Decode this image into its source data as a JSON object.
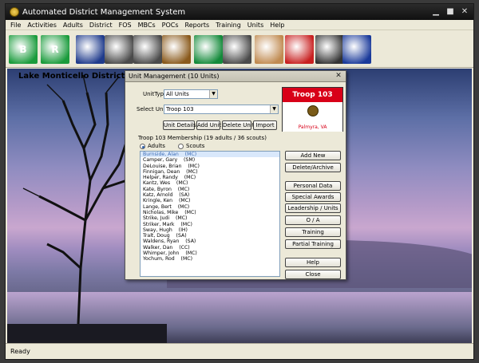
{
  "window": {
    "title": "Automated District Management System"
  },
  "menu": [
    "File",
    "Activities",
    "Adults",
    "District",
    "FOS",
    "MBCs",
    "POCs",
    "Reports",
    "Training",
    "Units",
    "Help"
  ],
  "toolbar": [
    {
      "name": "boys-to-men-icon",
      "label": "B",
      "color": "#1a9b3c"
    },
    {
      "name": "experience-icon",
      "label": "R",
      "color": "#1a9b3c"
    },
    {
      "name": "book-icon",
      "label": "",
      "color": "#1f3b8c"
    },
    {
      "name": "magnifier-icon",
      "label": "",
      "color": "#4a4a4a"
    },
    {
      "name": "register-icon",
      "label": "",
      "color": "#4a4a4a"
    },
    {
      "name": "meeting-icon",
      "label": "",
      "color": "#8a5a1c"
    },
    {
      "name": "fleur-de-lis-icon",
      "label": "",
      "color": "#138a3a"
    },
    {
      "name": "person-document-icon",
      "label": "",
      "color": "#4a4a4a"
    },
    {
      "name": "face-icon",
      "label": "",
      "color": "#c08a50"
    },
    {
      "name": "medal-icon",
      "label": "",
      "color": "#c82020"
    },
    {
      "name": "soccer-icon",
      "label": "",
      "color": "#333333"
    },
    {
      "name": "flag-icon",
      "label": "",
      "color": "#1a3a9a"
    }
  ],
  "desktop": {
    "district": "Lake Monticello District"
  },
  "status": "Ready",
  "dialog": {
    "title": "Unit Management  (10 Units)",
    "unit_type_label": "UnitType:",
    "unit_type_value": "All Units",
    "select_unit_label": "Select Unit:",
    "select_unit_value": "Troop 103",
    "buttons_top": [
      "Unit Details",
      "Add Unit",
      "Delete Unit",
      "Import"
    ],
    "membership": "Troop 103 Membership  (19 adults / 36 scouts)",
    "radio_adults": "Adults",
    "radio_scouts": "Scouts",
    "badge": {
      "title": "Troop 103",
      "location": "Palmyra, VA"
    },
    "members": [
      "Burnside, Alan    (MC)",
      "Camper, Gary    (SM)",
      "DeLouise, Brian    (MC)",
      "Finnigan, Dean    (MC)",
      "Helper, Randy    (MC)",
      "Kantz, Wes    (MC)",
      "Kate, Byron    (MC)",
      "Katz, Arnold    (SA)",
      "Kringle, Ken    (MC)",
      "Lange, Bert    (MC)",
      "Nicholas, Mike    (MC)",
      "Strike, Judi    (MC)",
      "Striker, Mark    (MC)",
      "Sway, Hugh    (IH)",
      "Tralt, Doug    (SA)",
      "Waldens, Ryan    (SA)",
      "Walker, Dan    (CC)",
      "Whimper, John    (MC)",
      "Yochum, Rod    (MC)"
    ],
    "right_buttons": [
      "Add New",
      "Delete/Archive",
      "Personal Data",
      "Special Awards",
      "Leadership / Units",
      "O / A",
      "Training",
      "Partial Training",
      "Help",
      "Close"
    ]
  }
}
